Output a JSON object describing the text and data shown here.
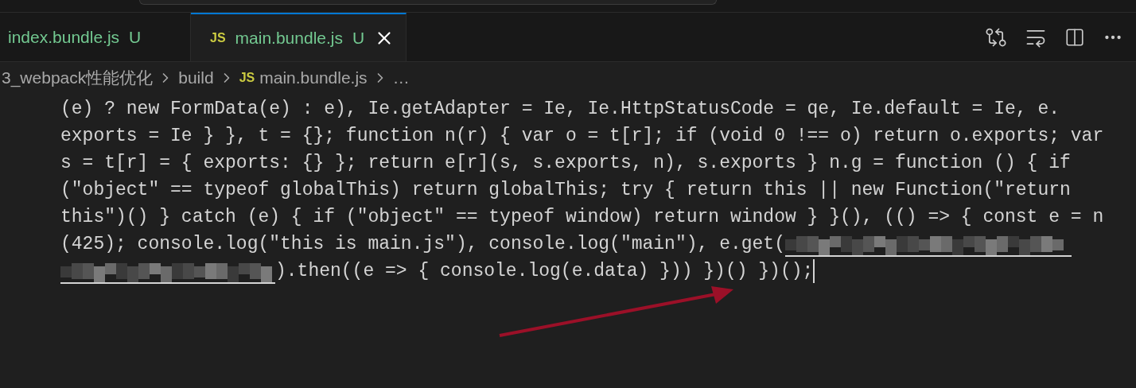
{
  "tabs": [
    {
      "label": "index.bundle.js",
      "badge": "U",
      "kind": "plain",
      "selected": false
    },
    {
      "label": "main.bundle.js",
      "badge": "U",
      "kind": "js",
      "icon_text": "JS",
      "selected": true
    }
  ],
  "breadcrumb": [
    {
      "label": "3_webpack性能优化",
      "kind": "folder"
    },
    {
      "label": "build",
      "kind": "folder"
    },
    {
      "label": "main.bundle.js",
      "kind": "js",
      "icon_text": "JS"
    }
  ],
  "breadcrumb_more": "…",
  "code_lines": [
    [
      {
        "kind": "text",
        "text": "(e) ? new FormData(e) : e), Ie.getAdapter = Ie, Ie.HttpStatusCode = qe, Ie.default = Ie, e."
      }
    ],
    [
      {
        "kind": "text",
        "text": "exports = Ie } }, t = {}; function n(r) { var o = t[r]; if (void 0 !== o) return o.exports; var"
      }
    ],
    [
      {
        "kind": "text",
        "text": "s = t[r] = { exports: {} }; return e[r](s, s.exports, n), s.exports } n.g = function () { if"
      }
    ],
    [
      {
        "kind": "text",
        "text": "(\"object\" == typeof globalThis) return globalThis; try { return this || new Function(\"return"
      }
    ],
    [
      {
        "kind": "text",
        "text": "this\")() } catch (e) { if (\"object\" == typeof window) return window } }(), (() => { const e = n"
      }
    ],
    [
      {
        "kind": "text",
        "text": "(425); console.log(\"this is main.js\"), console.log(\"main\"), e.get("
      },
      {
        "kind": "redacted_tail"
      }
    ],
    [
      {
        "kind": "redacted_head"
      },
      {
        "kind": "text",
        "text": ").then((e => { console.log(e.data) })) })() })();"
      },
      {
        "kind": "cursor"
      }
    ]
  ]
}
